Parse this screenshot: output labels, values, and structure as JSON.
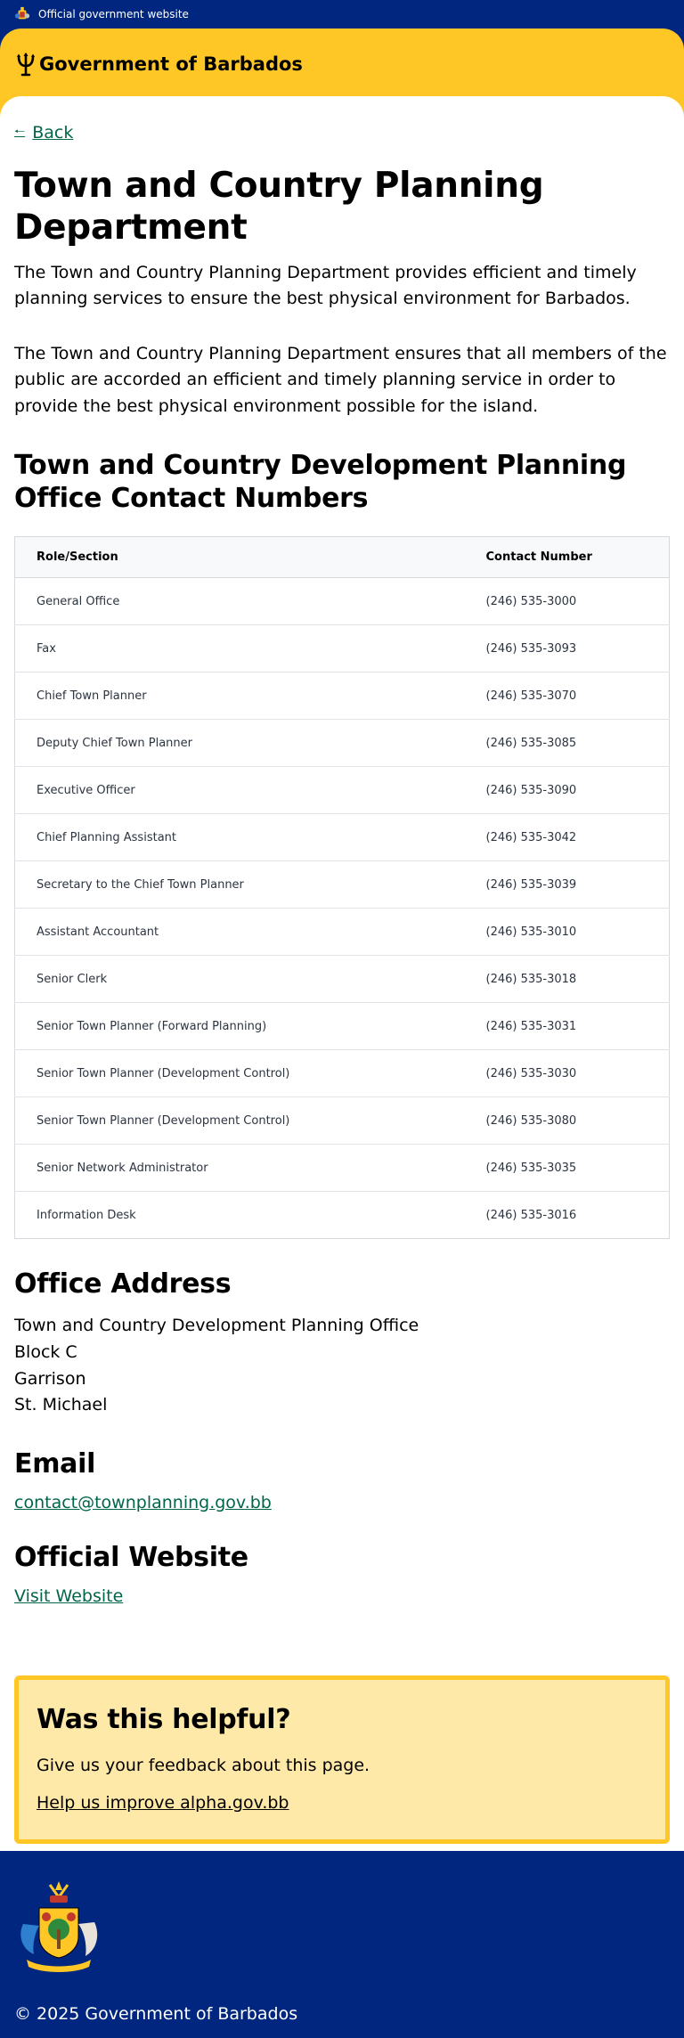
{
  "topbar": {
    "text": "Official government website"
  },
  "header": {
    "brand": "Government of Barbados"
  },
  "nav": {
    "back_label": "Back"
  },
  "page": {
    "title": "Town and Country Planning Department",
    "intro_1": "The Town and Country Planning Department provides efficient and timely planning services to ensure the best physical environment for Barbados.",
    "intro_2": "The Town and Country Planning Department ensures that all members of the public are accorded an efficient and timely planning service in order to provide the best physical environment possible for the island."
  },
  "contacts": {
    "heading": "Town and Country Development Planning Office Contact Numbers",
    "columns": [
      "Role/Section",
      "Contact Number"
    ],
    "rows": [
      [
        "General Office",
        "(246) 535-3000"
      ],
      [
        "Fax",
        "(246) 535-3093"
      ],
      [
        "Chief Town Planner",
        "(246) 535-3070"
      ],
      [
        "Deputy Chief Town Planner",
        "(246) 535-3085"
      ],
      [
        "Executive Officer",
        "(246) 535-3090"
      ],
      [
        "Chief Planning Assistant",
        "(246) 535-3042"
      ],
      [
        "Secretary to the Chief Town Planner",
        "(246) 535-3039"
      ],
      [
        "Assistant Accountant",
        "(246) 535-3010"
      ],
      [
        "Senior Clerk",
        "(246) 535-3018"
      ],
      [
        "Senior Town Planner (Forward Planning)",
        "(246) 535-3031"
      ],
      [
        "Senior Town Planner (Development Control)",
        "(246) 535-3030"
      ],
      [
        "Senior Town Planner (Development Control)",
        "(246) 535-3080"
      ],
      [
        "Senior Network Administrator",
        "(246) 535-3035"
      ],
      [
        "Information Desk",
        "(246) 535-3016"
      ]
    ]
  },
  "address": {
    "heading": "Office Address",
    "lines": [
      "Town and Country Development Planning Office",
      "Block C",
      "Garrison",
      "St. Michael"
    ]
  },
  "email": {
    "heading": "Email",
    "link": "contact@townplanning.gov.bb"
  },
  "website": {
    "heading": "Official Website",
    "link": "Visit Website"
  },
  "feedback": {
    "heading": "Was this helpful?",
    "text": "Give us your feedback about this page.",
    "link": "Help us improve alpha.gov.bb"
  },
  "footer": {
    "copyright": "© 2025 Government of Barbados"
  },
  "colors": {
    "navy": "#00267f",
    "gold": "#ffc726",
    "link_green": "#00654a",
    "feedback_bg": "#ffe9a8"
  },
  "icons": [
    "coat-of-arms-icon",
    "trident-icon",
    "back-arrow-icon"
  ]
}
